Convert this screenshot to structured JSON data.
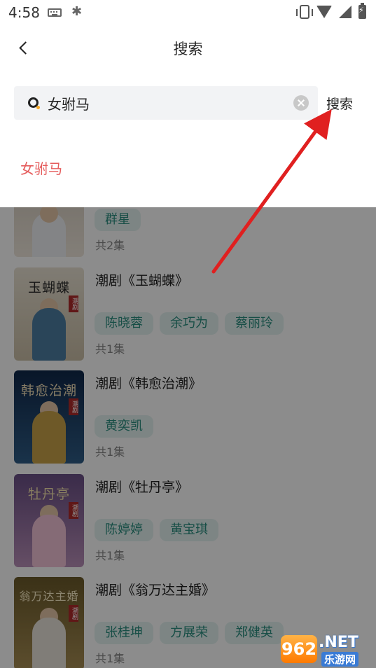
{
  "status_bar": {
    "time": "4:58",
    "left_icons": [
      "keyboard-icon",
      "app-glyph-icon"
    ],
    "right_icons": [
      "vibrate-icon",
      "wifi-icon",
      "signal-icon",
      "battery-charging-icon"
    ]
  },
  "header": {
    "title": "搜索",
    "back_icon": "chevron-left-icon"
  },
  "search": {
    "value": "女驸马",
    "icon": "search-icon",
    "clear_icon": "clear-icon",
    "button_label": "搜索"
  },
  "suggestions": [
    "女驸马"
  ],
  "results": [
    {
      "title": "",
      "thumb_title": "",
      "actors": [
        "群星"
      ],
      "episodes": "共2集"
    },
    {
      "title": "潮剧《玉蝴蝶》",
      "thumb_title": "玉蝴蝶",
      "actors": [
        "陈晓蓉",
        "余巧为",
        "蔡丽玲"
      ],
      "episodes": "共1集"
    },
    {
      "title": "潮剧《韩愈治潮》",
      "thumb_title": "韩愈治潮",
      "actors": [
        "黄奕凯"
      ],
      "episodes": "共1集"
    },
    {
      "title": "潮剧《牡丹亭》",
      "thumb_title": "牡丹亭",
      "actors": [
        "陈婷婷",
        "黄宝琪"
      ],
      "episodes": "共1集"
    },
    {
      "title": "潮剧《翁万达主婚》",
      "thumb_title": "翁万达主婚",
      "actors": [
        "张桂坤",
        "方展荣",
        "郑健英"
      ],
      "episodes": "共1集"
    }
  ],
  "thumb_seal": "潮剧",
  "watermark": {
    "badge": "962",
    "suffix": ".NET",
    "sub": "乐游网"
  },
  "colors": {
    "accent_tag_bg": "#e4f3f1",
    "accent_tag_text": "#2b8f80",
    "suggestion_text": "#e55c5c",
    "arrow": "#e02020"
  }
}
